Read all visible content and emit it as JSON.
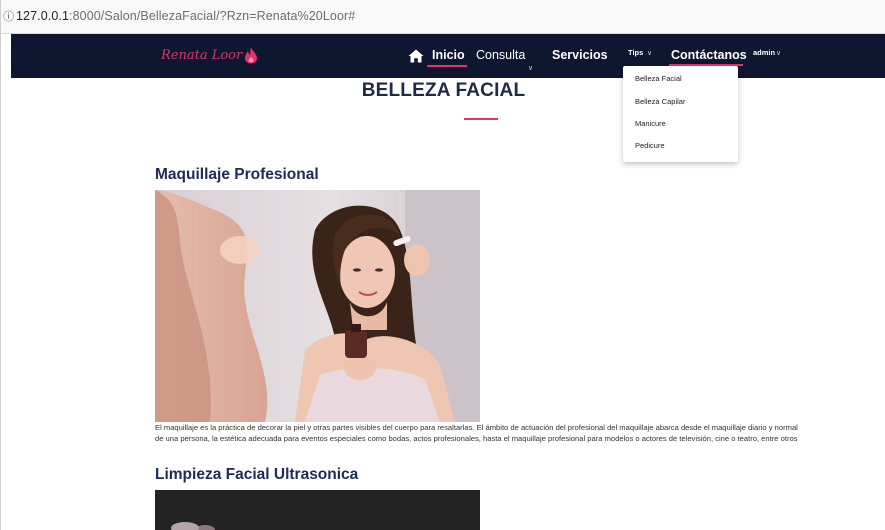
{
  "browser": {
    "url_host": "127.0.0.1",
    "url_rest": ":8000/Salon/BellezaFacial/?Rzn=Renata%20Loor#"
  },
  "navbar": {
    "brand": "Renata Loor",
    "links": {
      "inicio": "Inicio",
      "consulta": "Consulta",
      "servicios": "Servicios",
      "tips": "Tips",
      "contactanos": "Contáctanos",
      "admin": "admin"
    },
    "icons": {
      "home": "home-icon",
      "brand": "flame-drop-icon",
      "caret": "chevron-down-icon"
    },
    "colors": {
      "background": "#0f1630",
      "accent": "#e0336a"
    }
  },
  "tips_dropdown": {
    "items": [
      "Belleza Facial",
      "Belleza Capilar",
      "Manicure",
      "Pedicure"
    ]
  },
  "page": {
    "title": "BELLEZA FACIAL",
    "sections": [
      {
        "title": "Maquillaje Profesional",
        "description": "El maquillaje es la práctica de decorar la piel y otras partes visibles del cuerpo para resaltarlas. El ámbito de actuación del profesional del maquillaje abarca desde el maquillaje diario y normal de una persona, la estética adecuada para eventos especiales como bodas, actos profesionales, hasta el maquillaje profesional para modelos o actores de televisión, cine o teatro, entre otros"
      },
      {
        "title": "Limpieza Facial Ultrasonica"
      }
    ]
  }
}
